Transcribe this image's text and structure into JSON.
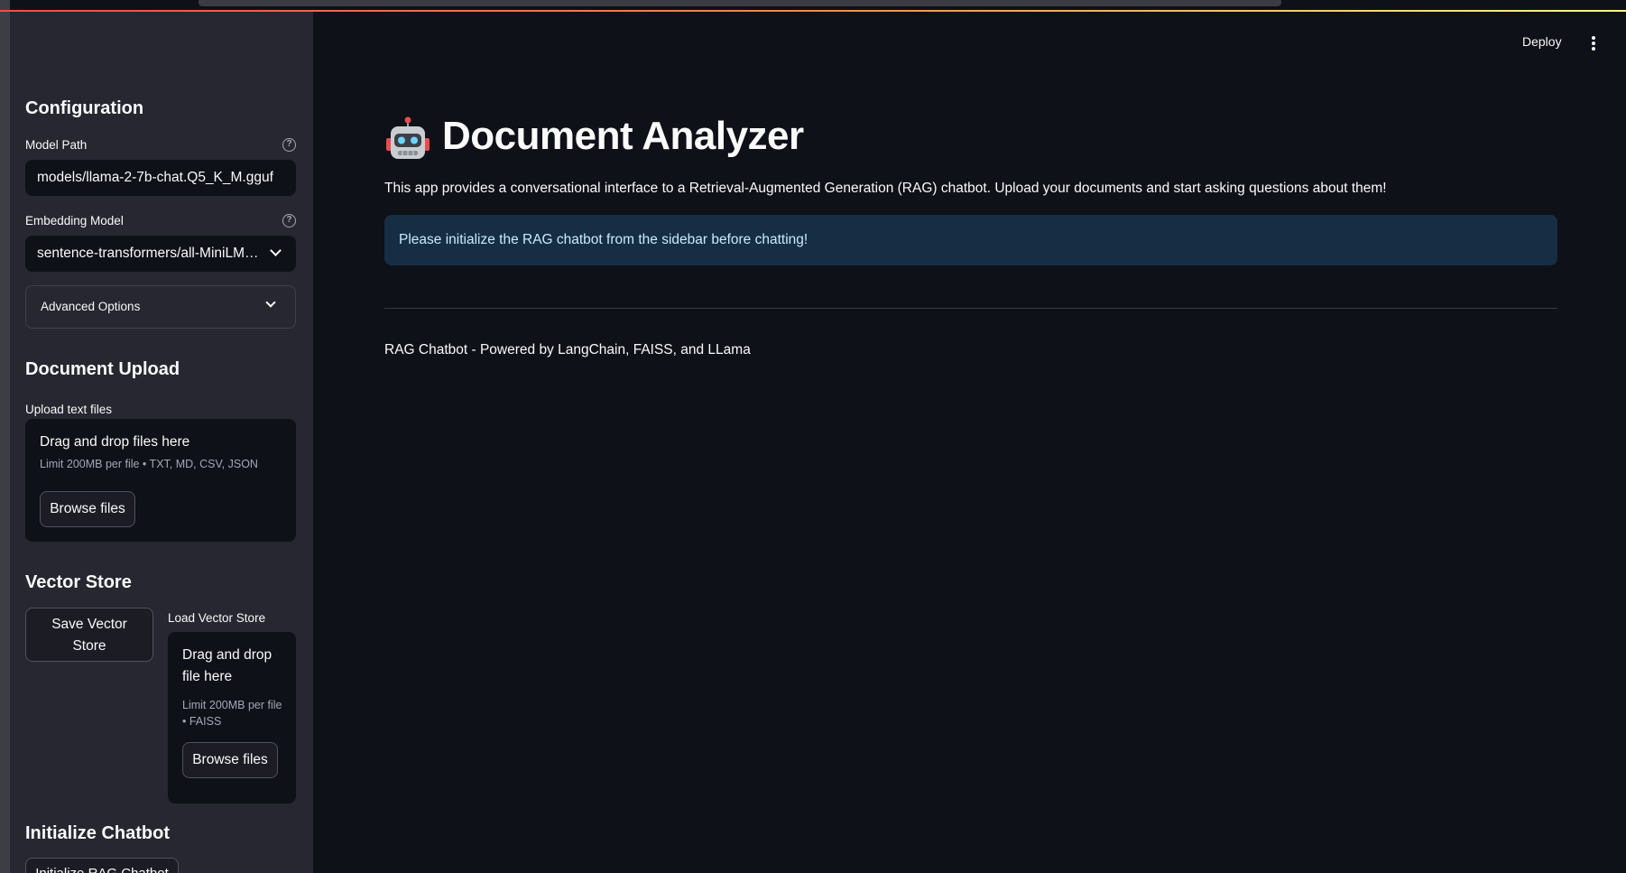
{
  "sidebar": {
    "configuration_heading": "Configuration",
    "model_path_label": "Model Path",
    "model_path_value": "models/llama-2-7b-chat.Q5_K_M.gguf",
    "embedding_model_label": "Embedding Model",
    "embedding_model_value": "sentence-transformers/all-MiniLM…",
    "advanced_options_label": "Advanced Options",
    "document_upload_heading": "Document Upload",
    "upload_label": "Upload text files",
    "upload_dropzone": {
      "title": "Drag and drop files here",
      "limit": "Limit 200MB per file • TXT, MD, CSV, JSON",
      "browse_label": "Browse files"
    },
    "vector_store_heading": "Vector Store",
    "save_vector_store_label": "Save Vector Store",
    "load_vector_store_label": "Load Vector Store",
    "load_dropzone": {
      "title": "Drag and drop file here",
      "limit": "Limit 200MB per file • FAISS",
      "browse_label": "Browse files"
    },
    "initialize_heading": "Initialize Chatbot",
    "initialize_button_label": "Initialize RAG Chatbot"
  },
  "header": {
    "deploy_label": "Deploy",
    "menu_icon": "kebab-menu-icon"
  },
  "main": {
    "title_icon": "robot-icon",
    "title": "Document Analyzer",
    "intro": "This app provides a conversational interface to a Retrieval-Augmented Generation (RAG) chatbot. Upload your documents and start asking questions about them!",
    "info_message": "Please initialize the RAG chatbot from the sidebar before chatting!",
    "footer": "RAG Chatbot - Powered by LangChain, FAISS, and LLama"
  },
  "colors": {
    "background": "#0e1117",
    "sidebar": "#262730",
    "info_bg": "#172d43",
    "info_text": "#c7ebff",
    "accent": "#ff4b4b"
  }
}
